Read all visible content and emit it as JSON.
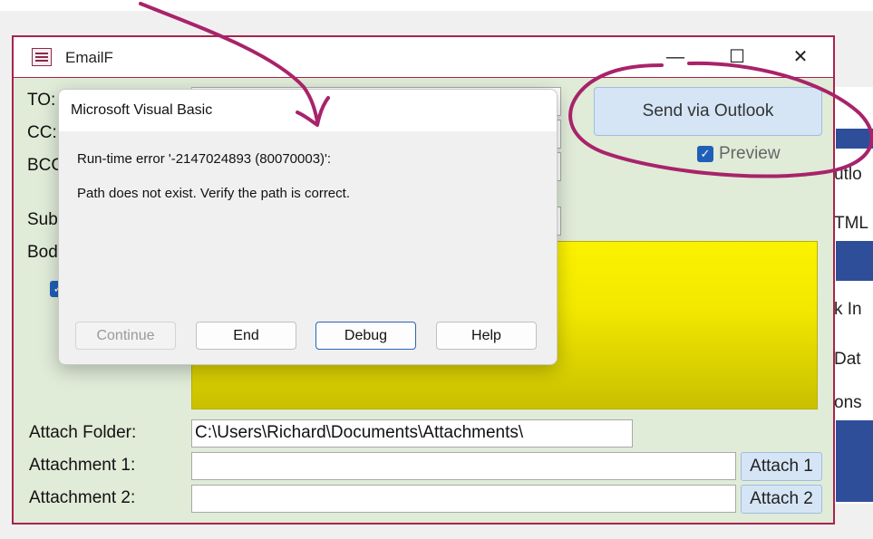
{
  "window": {
    "title": "EmailF",
    "icon": "form-icon",
    "minimize": "—",
    "maximize": "☐",
    "close": "✕"
  },
  "form": {
    "labels": {
      "to": "TO:",
      "cc": "CC:",
      "bcc": "BCC",
      "subject": "Sub",
      "body": "Bod"
    },
    "send_button": "Send via Outlook",
    "preview_label": "Preview",
    "preview_checked": true,
    "attach_folder_label": "Attach Folder:",
    "attach_folder_value": "C:\\Users\\Richard\\Documents\\Attachments\\",
    "attachment1_label": "Attachment 1:",
    "attachment2_label": "Attachment 2:",
    "attach1_button": "Attach 1",
    "attach2_button": "Attach 2"
  },
  "background_panel": {
    "items": [
      "utlo",
      "TML",
      "k In",
      "Dat",
      "ons"
    ]
  },
  "dialog": {
    "title": "Microsoft Visual Basic",
    "line1": "Run-time error '-2147024893 (80070003)':",
    "line2": "Path does not exist. Verify the path is correct.",
    "buttons": {
      "continue": "Continue",
      "end": "End",
      "debug": "Debug",
      "help": "Help"
    }
  },
  "colors": {
    "annotation": "#a8236a",
    "form_bg": "#e0ebd8",
    "border": "#a8234c",
    "yellow": "#f6ec00",
    "accent_blue": "#2f4e9a"
  }
}
